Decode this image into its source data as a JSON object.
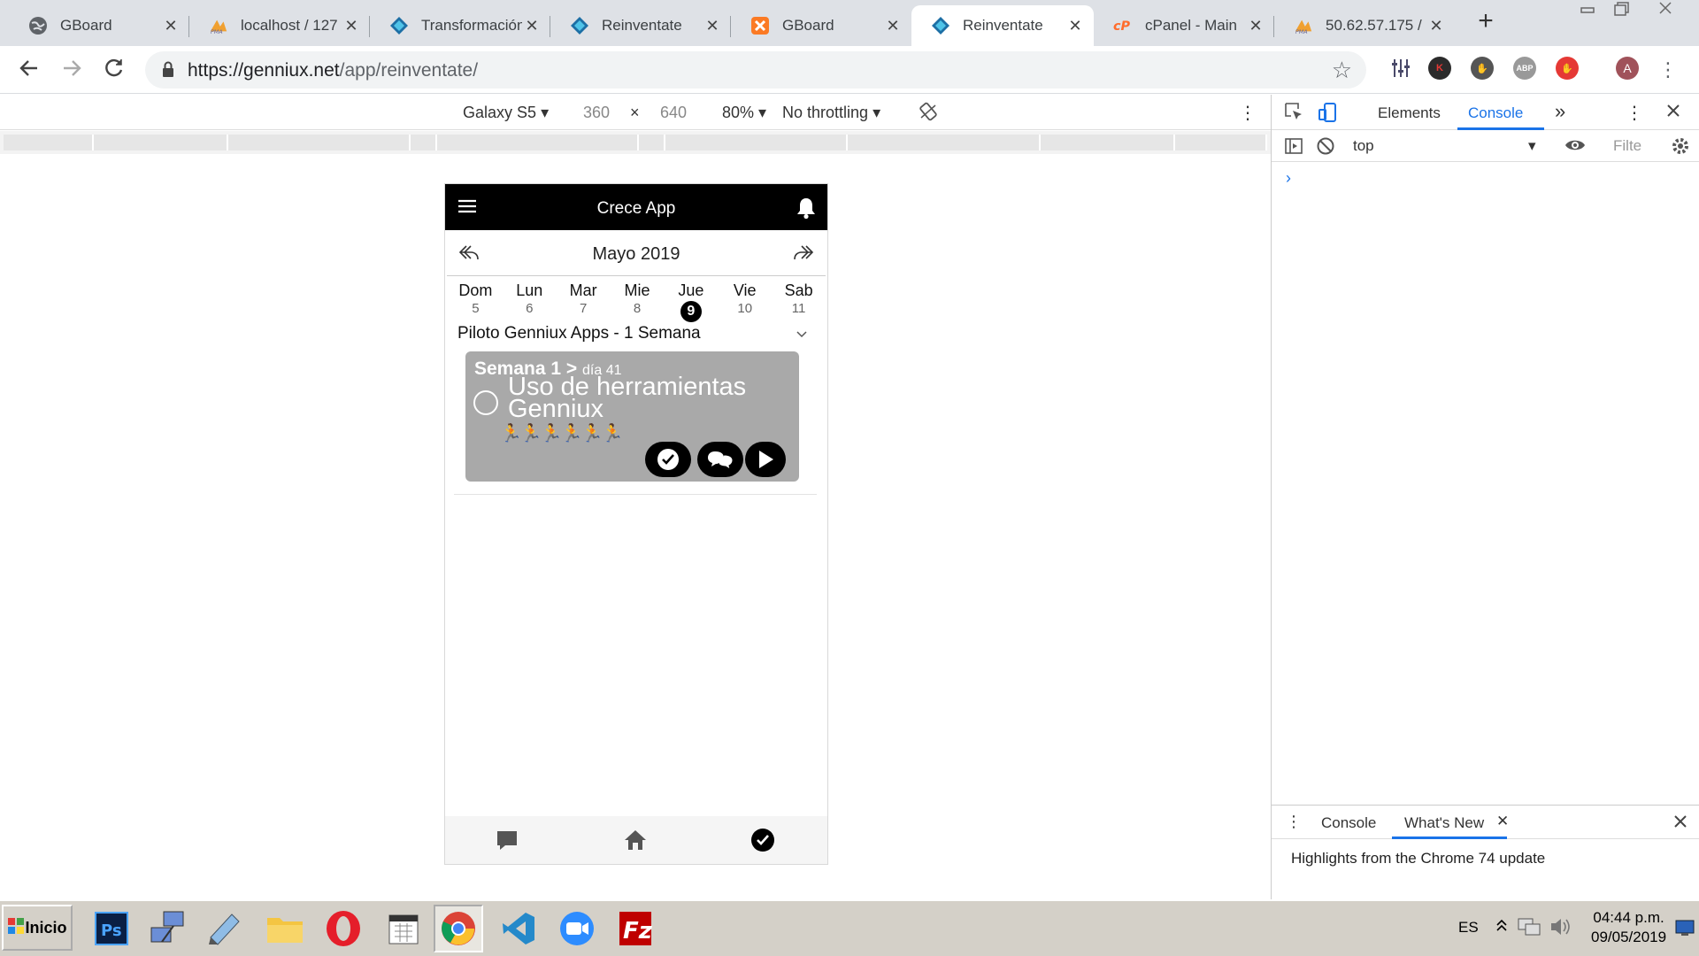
{
  "browser": {
    "tabs": [
      {
        "title": "GBoard",
        "icon": "globe-icon",
        "active": false
      },
      {
        "title": "localhost / 127",
        "icon": "phpmyadmin-icon",
        "active": false
      },
      {
        "title": "Transformación",
        "icon": "genniux-icon",
        "active": false
      },
      {
        "title": "Reinventate",
        "icon": "genniux-icon",
        "active": false
      },
      {
        "title": "GBoard",
        "icon": "xampp-icon",
        "active": false
      },
      {
        "title": "Reinventate",
        "icon": "genniux-icon",
        "active": true
      },
      {
        "title": "cPanel - Main",
        "icon": "cpanel-icon",
        "active": false
      },
      {
        "title": "50.62.57.175 /",
        "icon": "phpmyadmin-icon",
        "active": false
      }
    ],
    "url_host": "https://genniux.net",
    "url_path": "/app/reinventate/",
    "profile_initial": "A"
  },
  "device_toolbar": {
    "device": "Galaxy S5",
    "width": "360",
    "times": "×",
    "height": "640",
    "zoom": "80%",
    "throttling": "No throttling"
  },
  "app": {
    "header_title": "Crece App",
    "month": "Mayo 2019",
    "week": [
      {
        "name": "Dom",
        "date": "5"
      },
      {
        "name": "Lun",
        "date": "6"
      },
      {
        "name": "Mar",
        "date": "7"
      },
      {
        "name": "Mie",
        "date": "8"
      },
      {
        "name": "Jue",
        "date": "9",
        "selected": true
      },
      {
        "name": "Vie",
        "date": "10"
      },
      {
        "name": "Sab",
        "date": "11"
      }
    ],
    "program": "Piloto Genniux Apps - 1 Semana",
    "card": {
      "crumb": "Semana 1 >",
      "crumb_sub": "día 41",
      "title": "Uso de herramientas Genniux",
      "runners": "🏃🏃🏃🏃🏃🏃"
    }
  },
  "devtools": {
    "tabs": [
      "Elements",
      "Console"
    ],
    "active_tab": "Console",
    "more": "»",
    "context": "top",
    "filter_placeholder": "Filte",
    "prompt": "›",
    "drawer_tabs": [
      "Console",
      "What's New"
    ],
    "drawer_message": "Highlights from the Chrome 74 update"
  },
  "taskbar": {
    "start_label": "Inicio",
    "language": "ES",
    "time": "04:44 p.m.",
    "date": "09/05/2019"
  },
  "colors": {
    "accent": "#1a73e8",
    "card": "#a9a9a9",
    "app_header": "#000000"
  }
}
